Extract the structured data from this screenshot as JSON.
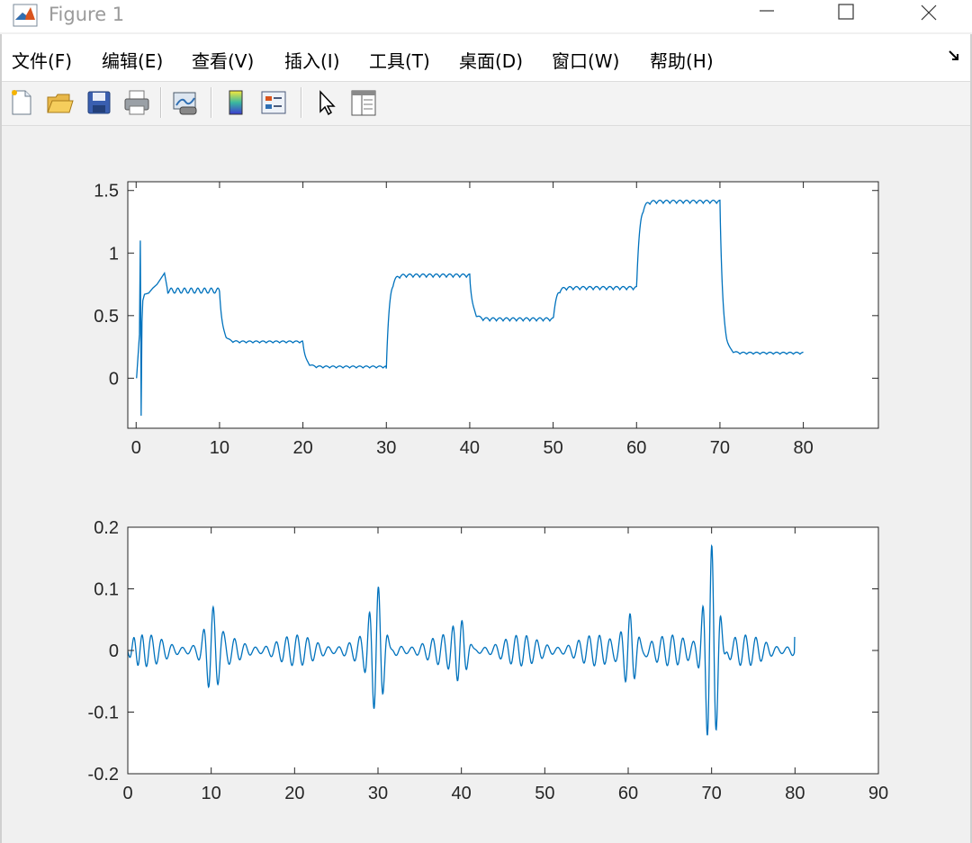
{
  "window": {
    "title": "Figure 1",
    "icon": "matlab-icon",
    "controls": [
      "minimize-icon",
      "maximize-icon",
      "close-icon"
    ]
  },
  "menu": {
    "items": [
      {
        "label": "文件(F)"
      },
      {
        "label": "编辑(E)"
      },
      {
        "label": "查看(V)"
      },
      {
        "label": "插入(I)"
      },
      {
        "label": "工具(T)"
      },
      {
        "label": "桌面(D)"
      },
      {
        "label": "窗口(W)"
      },
      {
        "label": "帮助(H)"
      }
    ],
    "dock_icon": "dock-arrow-icon"
  },
  "toolbar": {
    "buttons": [
      "new-figure-icon",
      "open-file-icon",
      "save-icon",
      "print-icon",
      "link-plot-icon",
      "colorbar-icon",
      "legend-icon",
      "edit-plot-icon",
      "property-inspector-icon"
    ]
  },
  "colors": {
    "line": "#0072bd",
    "axes_bg": "#ffffff",
    "figure_bg": "#f0f0f0"
  },
  "chart_data": [
    {
      "type": "line",
      "title": "",
      "xlabel": "",
      "ylabel": "",
      "xlim": [
        -1,
        89
      ],
      "ylim": [
        -0.4,
        1.57
      ],
      "xticks": [
        0,
        10,
        20,
        30,
        40,
        50,
        60,
        70,
        80
      ],
      "yticks": [
        0,
        0.5,
        1,
        1.5
      ],
      "xtick_labels": [
        "0",
        "10",
        "20",
        "30",
        "40",
        "50",
        "60",
        "70",
        "80"
      ],
      "ytick_labels": [
        "0",
        "0.5",
        "1",
        "1.5"
      ],
      "grid": false,
      "series": [
        {
          "description_levels": [
            {
              "from": 0,
              "to": 10,
              "level": 0.7
            },
            {
              "from": 10,
              "to": 20,
              "level": 0.29
            },
            {
              "from": 20,
              "to": 30,
              "level": 0.09
            },
            {
              "from": 30,
              "to": 40,
              "level": 0.82
            },
            {
              "from": 40,
              "to": 50,
              "level": 0.47
            },
            {
              "from": 50,
              "to": 60,
              "level": 0.72
            },
            {
              "from": 60,
              "to": 70,
              "level": 1.41
            },
            {
              "from": 70,
              "to": 80,
              "level": 0.2
            }
          ],
          "x": [
            0,
            0.5,
            0.55,
            0.6,
            0.7,
            1.0,
            2.0,
            3.0,
            3.3,
            3.6,
            10,
            20,
            30,
            40,
            50,
            60,
            70,
            80
          ],
          "y": [
            0,
            1.1,
            -0.3,
            0.4,
            0.6,
            0.68,
            0.73,
            0.8,
            0.84,
            0.72,
            0.7,
            0.29,
            0.09,
            0.82,
            0.47,
            0.72,
            1.41,
            0.2
          ]
        }
      ]
    },
    {
      "type": "line",
      "title": "",
      "xlabel": "",
      "ylabel": "",
      "xlim": [
        0,
        90
      ],
      "ylim": [
        -0.2,
        0.2
      ],
      "xticks": [
        0,
        10,
        20,
        30,
        40,
        50,
        60,
        70,
        80,
        90
      ],
      "yticks": [
        -0.2,
        -0.1,
        0,
        0.1,
        0.2
      ],
      "xtick_labels": [
        "0",
        "10",
        "20",
        "30",
        "40",
        "50",
        "60",
        "70",
        "80",
        "90"
      ],
      "ytick_labels": [
        "-0.2",
        "-0.1",
        "0",
        "0.1",
        "0.2"
      ],
      "grid": false,
      "series": [
        {
          "x": [
            0,
            10,
            20,
            30,
            40,
            50,
            60,
            70,
            80
          ],
          "y": [
            0,
            0,
            0,
            0,
            0,
            0,
            0,
            0,
            0.02
          ],
          "bursts": [
            {
              "center": 0.8,
              "amplitude": 0.035
            },
            {
              "center": 10.2,
              "amplitude": 0.05
            },
            {
              "center": 30.0,
              "amplitude": 0.1
            },
            {
              "center": 40.0,
              "amplitude": 0.045
            },
            {
              "center": 60.2,
              "amplitude": 0.055
            },
            {
              "center": 70.0,
              "amplitude": 0.17
            }
          ],
          "baseline_amplitude": 0.025
        }
      ]
    }
  ]
}
